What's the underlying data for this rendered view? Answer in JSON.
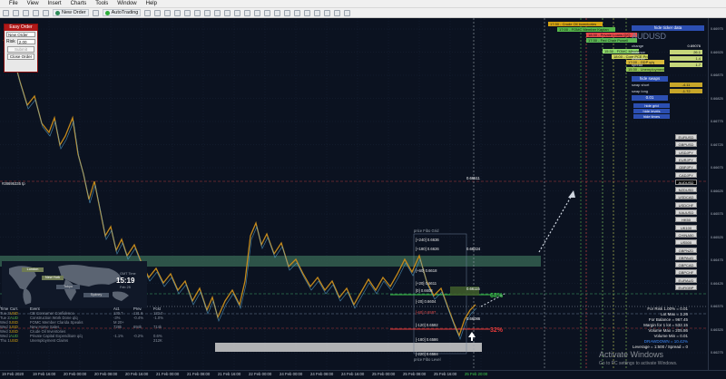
{
  "menu": [
    "File",
    "View",
    "Insert",
    "Charts",
    "Tools",
    "Window",
    "Help"
  ],
  "toolbar": {
    "new_order": "New Order",
    "autotrading": "AutoTrading"
  },
  "easy_order": {
    "title": "Easy Order",
    "order_type": "New Order",
    "risk_label": "Risk",
    "risk_value": "2.00",
    "submit": "Submit",
    "close_order": "Close Order"
  },
  "top_boxes": [
    {
      "text": "17:30 - Crude Oil Inventories",
      "color": "#d6a412"
    },
    {
      "text": "17:00 - FOMC Member Kaplan",
      "color": "#56b84b"
    },
    {
      "text": "18:30 - Private Loans Q/Q",
      "color": "#e84b4b"
    },
    {
      "text": "17:30 - Fed Chair Powell",
      "color": "#5cba55"
    },
    {
      "text": "15:30 - FOMC Minutes",
      "color": "#8fdc6c"
    },
    {
      "text": "18:00 - Core PCE Price",
      "color": "#cbd35a"
    },
    {
      "text": "17:00 - GDP q/q",
      "color": "#d8b83a"
    },
    {
      "text": "15:30 - Unemployment Claims",
      "color": "#96c957"
    }
  ],
  "right_panel": {
    "hide_button": "hide ticker data",
    "symbol": "AUDUSD",
    "rows": [
      {
        "label": "change",
        "value": "0.69076"
      },
      {
        "label": "distance",
        "value": "26.1"
      },
      {
        "label": "distance",
        "value": "1.4"
      },
      {
        "label": "spread",
        "value": "1.7"
      }
    ],
    "swap_btn": "hide swaps",
    "swap_short_label": "swap short",
    "swap_long_label": "swap long",
    "swap_short": "-4.11",
    "swap_long": "-1.72",
    "trade_size": "0.01",
    "buttons": [
      "hide grid",
      "hide levels",
      "hide times"
    ],
    "pairs": [
      "EURUSD",
      "GBPUSD",
      "USDJPY",
      "EURJPY",
      "GBPJPY",
      "CADJPY",
      "AUDUSD",
      "NZDUSD",
      "USDCAD",
      "USDCHF",
      "XAUUSD",
      "HK50",
      "UK100",
      "CHINA50",
      "US500",
      "GBPNZD",
      "GBPAUD",
      "GBPCAD",
      "GBPCHF",
      "EURAUD",
      "EURGBP"
    ],
    "selected_pair": "AUDUSD"
  },
  "stats": [
    "For Risk 1.00% = 0.01",
    "Lot Max = 1.26",
    "For Balance = 967.45",
    "Margin for 1 lot = 532.15",
    "Volume Max = 205.86",
    "Volume Min = 0.01",
    "DRAWDOWN = 10.42%",
    "Leverage = 1:500 / Spread = 0"
  ],
  "levels": [
    {
      "text": "[+240]  0.6636",
      "color": "#e6e6e6"
    },
    {
      "text": "[+180]  0.6626",
      "color": "#e6e6e6"
    },
    {
      "text": "[+60]  0.6618",
      "color": "#e6e6e6"
    },
    {
      "text": "[+20]  0.6611",
      "color": "#e6e6e6"
    },
    {
      "text": "[0]  0.6608",
      "color": "#e6e6e6"
    },
    {
      "text": "[-20]  0.6604",
      "color": "#e6e6e6"
    },
    {
      "text": "[-60]  0.6597",
      "color": "#e04a4a"
    },
    {
      "text": "[-120]  0.6592",
      "color": "#e6e6e6"
    },
    {
      "text": "[-180]  0.6586",
      "color": "#e6e6e6"
    },
    {
      "text": "[-220]  0.6584",
      "color": "#e6e6e6"
    }
  ],
  "annotations": {
    "price_tag_1": "0.66511",
    "price_tag_2": "0.66224",
    "price_tag_3": "0.66115",
    "price_tag_4": "0.66086",
    "pct_up": "68%",
    "pct_down": "32%",
    "left_tag": "#28695335 tp",
    "level_hint": "price Fibo Grid",
    "level_hint2": "price Fibo Level"
  },
  "world_clock": {
    "label": "GMT Time",
    "time": "15:19",
    "date": "Feb 25",
    "regions": [
      "Sydney",
      "Tokyo",
      "London",
      "New York"
    ]
  },
  "calendar": {
    "headers": [
      "Time",
      "Curr.",
      "",
      "Event",
      "Act.",
      "Prev.",
      "Fcst"
    ],
    "rows": [
      [
        "Tue 23:30",
        "USD",
        "",
        "CB Consumer Confidence",
        "130.7",
        "131.6",
        "132.0"
      ],
      [
        "Tue 22:00",
        "AUD",
        "",
        "Construction Work Done q/q",
        "-3%",
        "-0.4%",
        "-1.0%"
      ],
      [
        "Wed 00:50",
        "USD",
        "",
        "FOMC Member Clarida Speaks",
        "M 20+",
        "",
        ""
      ],
      [
        "Wed 12:00",
        "USD",
        "",
        "New Home Sales",
        "728k",
        "694k",
        "714k"
      ],
      [
        "Wed 17:30",
        "USD",
        "",
        "Crude Oil Inventories",
        "",
        "",
        ""
      ],
      [
        "Wed 21:30",
        "AUD",
        "",
        "Private Capital Expenditure q/q",
        "-1.1%",
        "-0.2%",
        "0.6%"
      ],
      [
        "Thu 12:00",
        "USD",
        "",
        "Unemployment Claims",
        "",
        "",
        "212K"
      ]
    ]
  },
  "time_ticks": [
    "19 Feb 2020",
    "19 Feb 16:00",
    "20 Feb 00:00",
    "20 Feb 08:00",
    "20 Feb 16:00",
    "21 Feb 00:00",
    "21 Feb 08:00",
    "21 Feb 16:00",
    "22 Feb 00:00",
    "24 Feb 00:00",
    "24 Feb 08:00",
    "24 Feb 16:00",
    "25 Feb 00:00",
    "25 Feb 08:00",
    "25 Feb 16:00",
    "25 Feb 20:00"
  ],
  "price_ticks": [
    "0.66975",
    "0.66925",
    "0.66875",
    "0.66825",
    "0.66775",
    "0.66725",
    "0.66675",
    "0.66625",
    "0.66575",
    "0.66525",
    "0.66475",
    "0.66425",
    "0.66375",
    "0.66325",
    "0.66275"
  ],
  "watermark": {
    "line1": "Activate Windows",
    "line2": "Go to PC settings to activate Windows."
  },
  "colors": {
    "background": "#0b1220",
    "candles": "#c58a1b",
    "zone_green": "#3a6a55",
    "zone_grey": "#cfcfcf",
    "price_line": "#e8e8e8",
    "accent_blue": "#2c4fb2",
    "green_pct": "#3fd04b",
    "red_pct": "#e63a3a"
  }
}
